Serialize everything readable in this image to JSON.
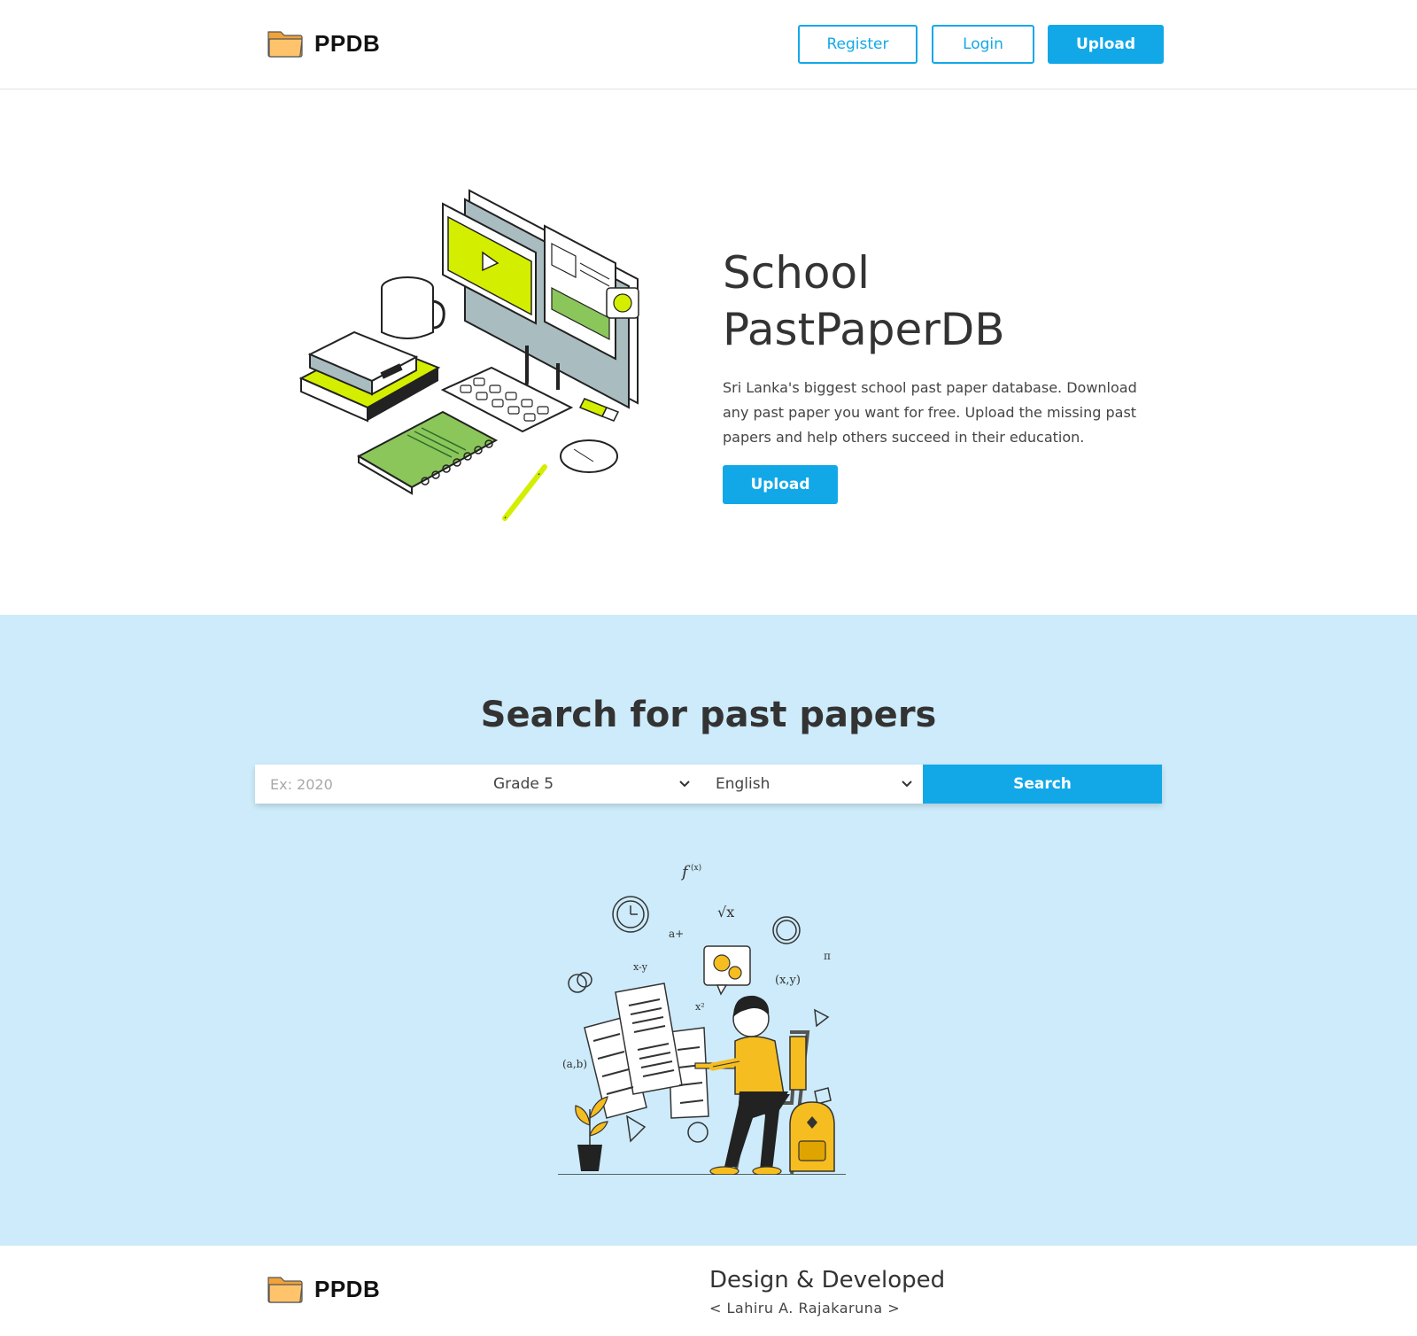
{
  "header": {
    "logo_text": "PPDB",
    "register_label": "Register",
    "login_label": "Login",
    "upload_label": "Upload"
  },
  "hero": {
    "title_line1": "School",
    "title_line2": "PastPaperDB",
    "description": "Sri Lanka's biggest school past paper database. Download any past paper you want for free. Upload the missing past papers and help others succeed in their education.",
    "upload_label": "Upload"
  },
  "search": {
    "title": "Search for past papers",
    "year_placeholder": "Ex: 2020",
    "grade_selected": "Grade 5",
    "language_selected": "English",
    "search_label": "Search"
  },
  "footer": {
    "logo_text": "PPDB",
    "credit_title": "Design & Developed",
    "credit_name": "< Lahiru A. Rajakaruna >"
  },
  "colors": {
    "accent": "#12a8e8",
    "band": "#cdebfa",
    "illustration_lime": "#d4ee00",
    "illustration_green": "#8bc65a",
    "illustration_yellow": "#f5bd1f"
  },
  "icons": {
    "logo": "folder-icon",
    "select_arrow": "chevron-down-icon"
  }
}
